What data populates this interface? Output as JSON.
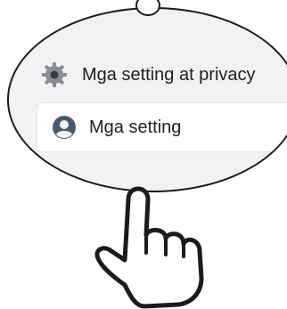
{
  "menu": {
    "settings_privacy_label": "Mga setting at privacy",
    "settings_label": "Mga setting"
  },
  "icons": {
    "settings_privacy": "gear-icon",
    "settings": "profile-icon",
    "pointer": "pointing-hand-icon"
  },
  "colors": {
    "lens_bg": "#f1f2f4",
    "card_bg": "#ffffff",
    "outline": "#1b1b1b",
    "text": "#1f1f1f",
    "icon_gray": "#8a8d93",
    "icon_dark": "#475a6b"
  }
}
